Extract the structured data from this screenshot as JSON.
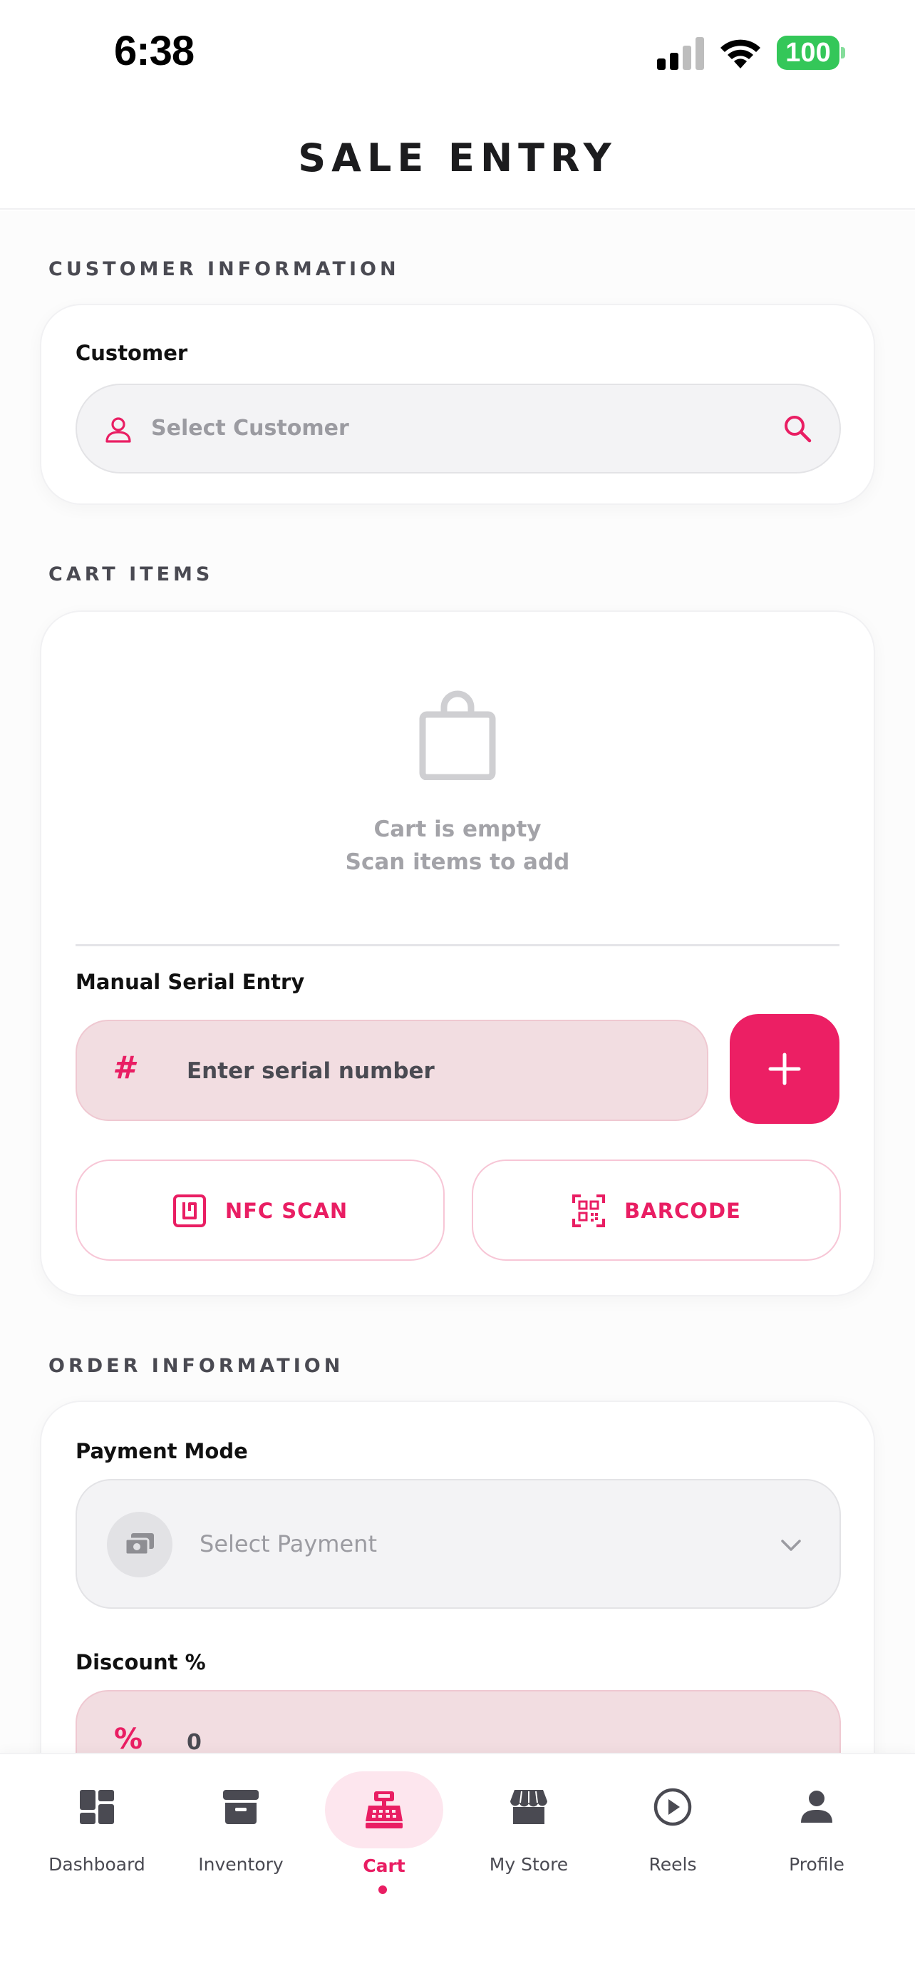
{
  "status_bar": {
    "time": "6:38",
    "battery": "100"
  },
  "header": {
    "title": "SALE ENTRY"
  },
  "customer_section": {
    "title": "CUSTOMER INFORMATION",
    "field_label": "Customer",
    "placeholder": "Select Customer"
  },
  "cart_section": {
    "title": "CART ITEMS",
    "empty_line1": "Cart is empty",
    "empty_line2": "Scan items to add",
    "manual_label": "Manual Serial Entry",
    "serial_placeholder": "Enter serial number",
    "nfc_label": "NFC SCAN",
    "barcode_label": "BARCODE"
  },
  "order_section": {
    "title": "ORDER INFORMATION",
    "payment_label": "Payment Mode",
    "payment_placeholder": "Select Payment",
    "discount_label": "Discount %",
    "discount_value": "0"
  },
  "tabs": [
    {
      "label": "Dashboard",
      "icon": "dashboard-icon",
      "active": false
    },
    {
      "label": "Inventory",
      "icon": "inventory-box-icon",
      "active": false
    },
    {
      "label": "Cart",
      "icon": "cash-register-icon",
      "active": true
    },
    {
      "label": "My Store",
      "icon": "store-icon",
      "active": false
    },
    {
      "label": "Reels",
      "icon": "play-circle-icon",
      "active": false
    },
    {
      "label": "Profile",
      "icon": "person-icon",
      "active": false
    }
  ],
  "colors": {
    "accent": "#e91e63",
    "accent_light": "#f2dde1",
    "battery": "#34c759"
  }
}
